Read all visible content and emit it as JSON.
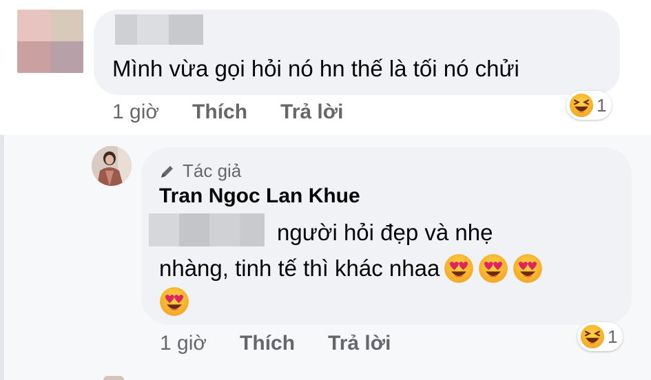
{
  "top_comment": {
    "text": "Mình vừa gọi hỏi nó hn thế là tối nó chửi",
    "time": "1 giờ",
    "like_label": "Thích",
    "reply_label": "Trả lời",
    "reaction_icon": "laughing-emoji-icon",
    "reaction_count": "1"
  },
  "reply": {
    "author_badge": "Tác giả",
    "author_badge_icon": "pencil-icon",
    "author_name": "Tran Ngoc Lan Khue",
    "text_line1": "người hỏi đẹp và nhẹ",
    "text_line2": "nhàng, tinh tế thì khác nhaa",
    "emojis": [
      "heart-eyes-emoji-icon",
      "heart-eyes-emoji-icon",
      "heart-eyes-emoji-icon",
      "heart-eyes-emoji-icon"
    ],
    "time": "1 giờ",
    "like_label": "Thích",
    "reply_label": "Trả lời",
    "reaction_icon": "laughing-emoji-icon",
    "reaction_count": "1"
  },
  "colors": {
    "bubble": "#f0f2f5",
    "meta_text": "#65676b",
    "emoji_yellow": "#f7b125",
    "heart_red": "#e0245e"
  }
}
